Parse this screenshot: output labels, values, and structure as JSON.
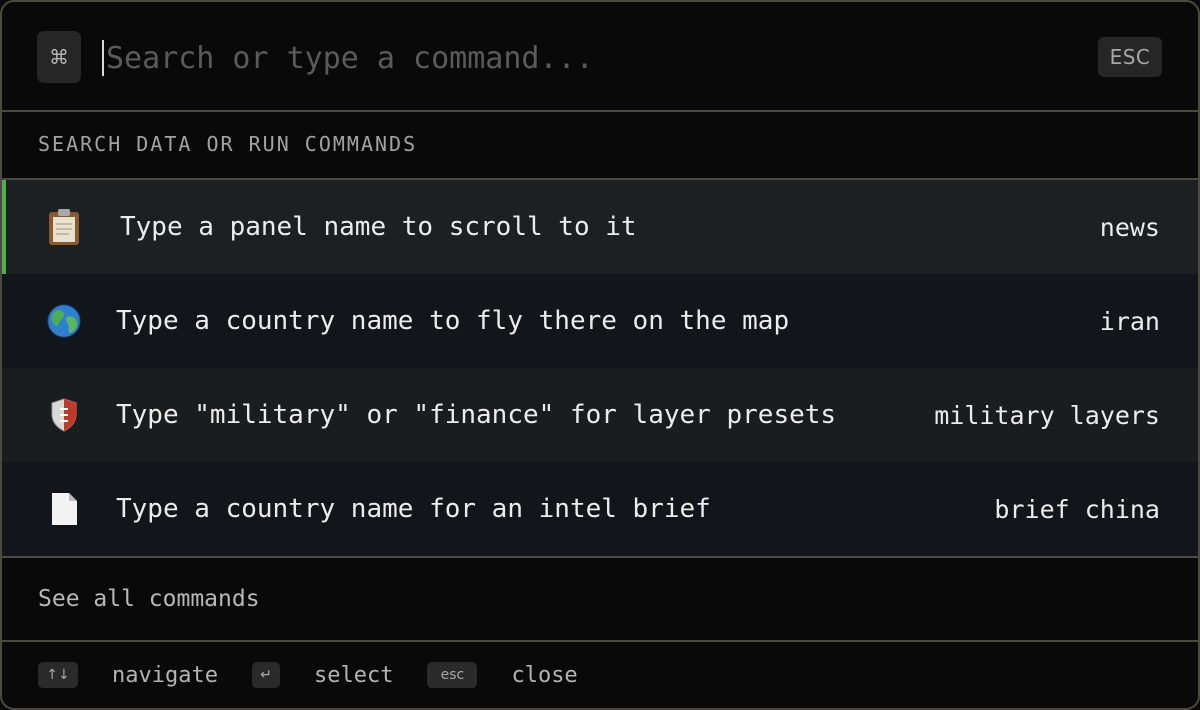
{
  "search": {
    "cmd_key": "⌘",
    "placeholder": "Search or type a command...",
    "esc_label": "ESC"
  },
  "section_heading": "SEARCH DATA OR RUN COMMANDS",
  "results": [
    {
      "icon": "clipboard-icon",
      "label": "Type a panel name to scroll to it",
      "hint": "news"
    },
    {
      "icon": "globe-icon",
      "label": "Type a country name to fly there on the map",
      "hint": "iran"
    },
    {
      "icon": "shield-icon",
      "label": "Type \"military\" or \"finance\" for layer presets",
      "hint": "military layers"
    },
    {
      "icon": "document-icon",
      "label": "Type a country name for an intel brief",
      "hint": "brief china"
    }
  ],
  "see_all": "See all commands",
  "footer": {
    "navigate_key": "↑↓",
    "navigate_label": "navigate",
    "select_key": "↵",
    "select_label": "select",
    "close_key": "esc",
    "close_label": "close"
  },
  "colors": {
    "accent": "#4caf50",
    "border": "#4a4a3f",
    "background": "#090909"
  }
}
